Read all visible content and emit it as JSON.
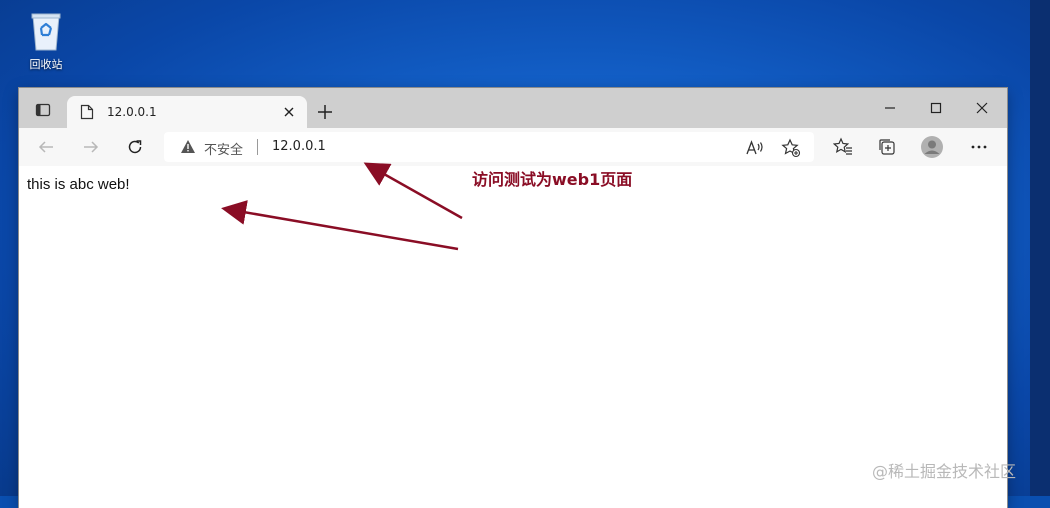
{
  "desktop": {
    "recycle_bin_label": "回收站",
    "icon": "recycle-bin-icon"
  },
  "browser": {
    "tab": {
      "title": "12.0.0.1",
      "favicon": "page-icon"
    },
    "address": {
      "security_label": "不安全",
      "url": "12.0.0.1",
      "security_icon": "warning-icon"
    },
    "toolbar_icons": [
      "back-icon",
      "forward-icon",
      "refresh-icon",
      "read-aloud-icon",
      "add-favorite-icon",
      "favorites-icon",
      "collections-icon",
      "profile-icon",
      "more-icon"
    ],
    "page_text": "this is abc web!"
  },
  "annotation": {
    "text": "访问测试为web1页面",
    "color": "#8a0d25"
  },
  "watermark": "@稀土掘金技术社区"
}
